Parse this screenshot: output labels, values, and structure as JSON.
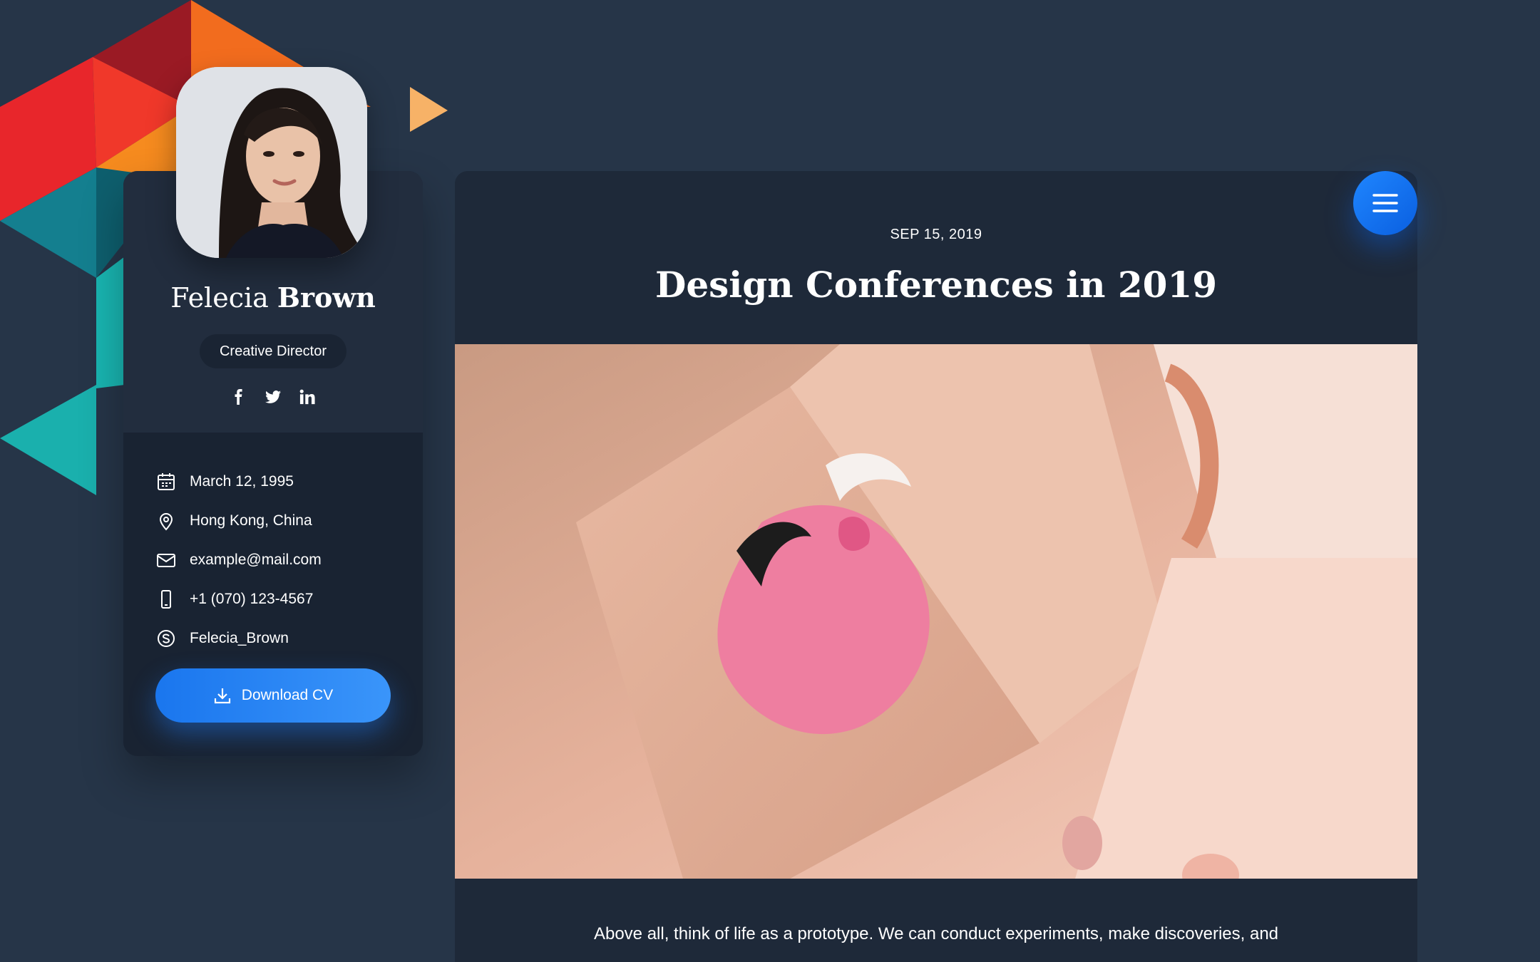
{
  "profile": {
    "first_name": "Felecia",
    "last_name": "Brown",
    "role": "Creative Director",
    "socials": [
      "facebook-icon",
      "twitter-icon",
      "linkedin-icon"
    ],
    "info": {
      "birthday": "March 12, 1995",
      "location": "Hong Kong, China",
      "email": "example@mail.com",
      "phone": "+1 (070) 123-4567",
      "skype": "Felecia_Brown"
    },
    "download_label": "Download CV"
  },
  "article": {
    "date": "SEP 15, 2019",
    "title": "Design Conferences in 2019",
    "excerpt": "Above all, think of life as a prototype. We can conduct experiments, make discoveries, and"
  },
  "colors": {
    "background": "#263548",
    "card": "#1f2a3a",
    "accent_blue": "#1a76ee"
  },
  "icons": {
    "menu": "hamburger-menu-icon",
    "download": "download-icon",
    "calendar": "calendar-icon",
    "location": "location-pin-icon",
    "email": "envelope-icon",
    "phone": "phone-icon",
    "skype": "skype-icon"
  }
}
